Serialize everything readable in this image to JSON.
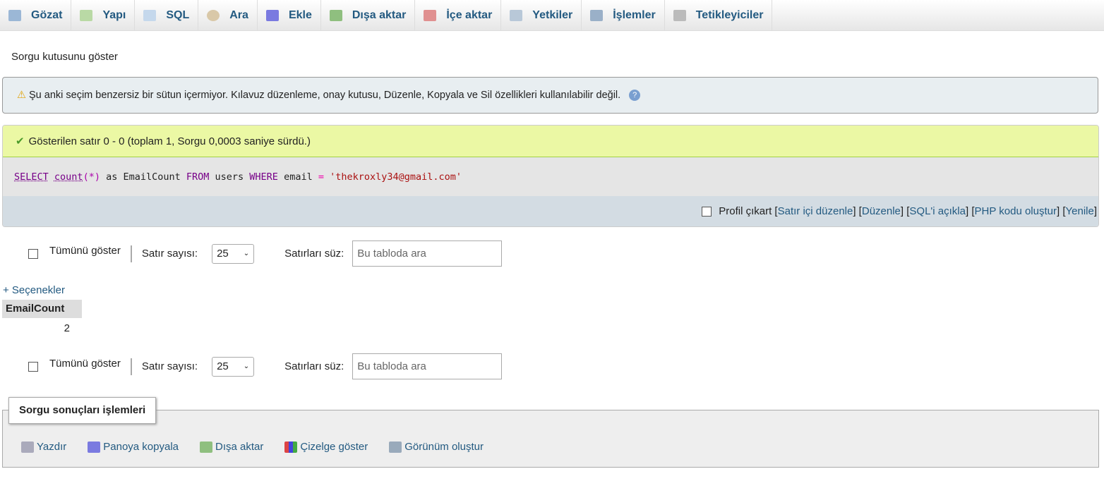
{
  "tabs": [
    {
      "label": "Gözat",
      "icon": "table-icon"
    },
    {
      "label": "Yapı",
      "icon": "structure-icon"
    },
    {
      "label": "SQL",
      "icon": "sql-icon"
    },
    {
      "label": "Ara",
      "icon": "search-icon"
    },
    {
      "label": "Ekle",
      "icon": "insert-icon"
    },
    {
      "label": "Dışa aktar",
      "icon": "export-icon"
    },
    {
      "label": "İçe aktar",
      "icon": "import-icon"
    },
    {
      "label": "Yetkiler",
      "icon": "privileges-icon"
    },
    {
      "label": "İşlemler",
      "icon": "wrench-icon"
    },
    {
      "label": "Tetikleyiciler",
      "icon": "triggers-icon"
    }
  ],
  "show_query_box": "Sorgu kutusunu göster",
  "notice": "Şu anki seçim benzersiz bir sütun içermiyor. Kılavuz düzenleme, onay kutusu, Düzenle, Kopyala ve Sil özellikleri kullanılabilir değil.",
  "success": "Gösterilen satır 0 - 0 (toplam 1, Sorgu 0,0003 saniye sürdü.)",
  "sql": {
    "select": "SELECT",
    "count": "count",
    "star": "(*)",
    "as": " as EmailCount ",
    "from": "FROM",
    "users": " users ",
    "where": "WHERE",
    "email": " email ",
    "eq": "=",
    "value": " 'thekroxly34@gmail.com'"
  },
  "query_tools": {
    "profile": "Profil çıkart",
    "links": [
      "Satır içi düzenle",
      "Düzenle",
      "SQL'i açıkla",
      "PHP kodu oluştur",
      "Yenile"
    ]
  },
  "nav": {
    "show_all": "Tümünü göster",
    "row_count_label": "Satır sayısı:",
    "row_count": "25",
    "filter_label": "Satırları süz:",
    "filter_placeholder": "Bu tabloda ara"
  },
  "options": "+ Seçenekler",
  "table": {
    "header": "EmailCount",
    "value": "2"
  },
  "ops": {
    "title": "Sorgu sonuçları işlemleri",
    "items": [
      "Yazdır",
      "Panoya kopyala",
      "Dışa aktar",
      "Çizelge göster",
      "Görünüm oluştur"
    ]
  }
}
